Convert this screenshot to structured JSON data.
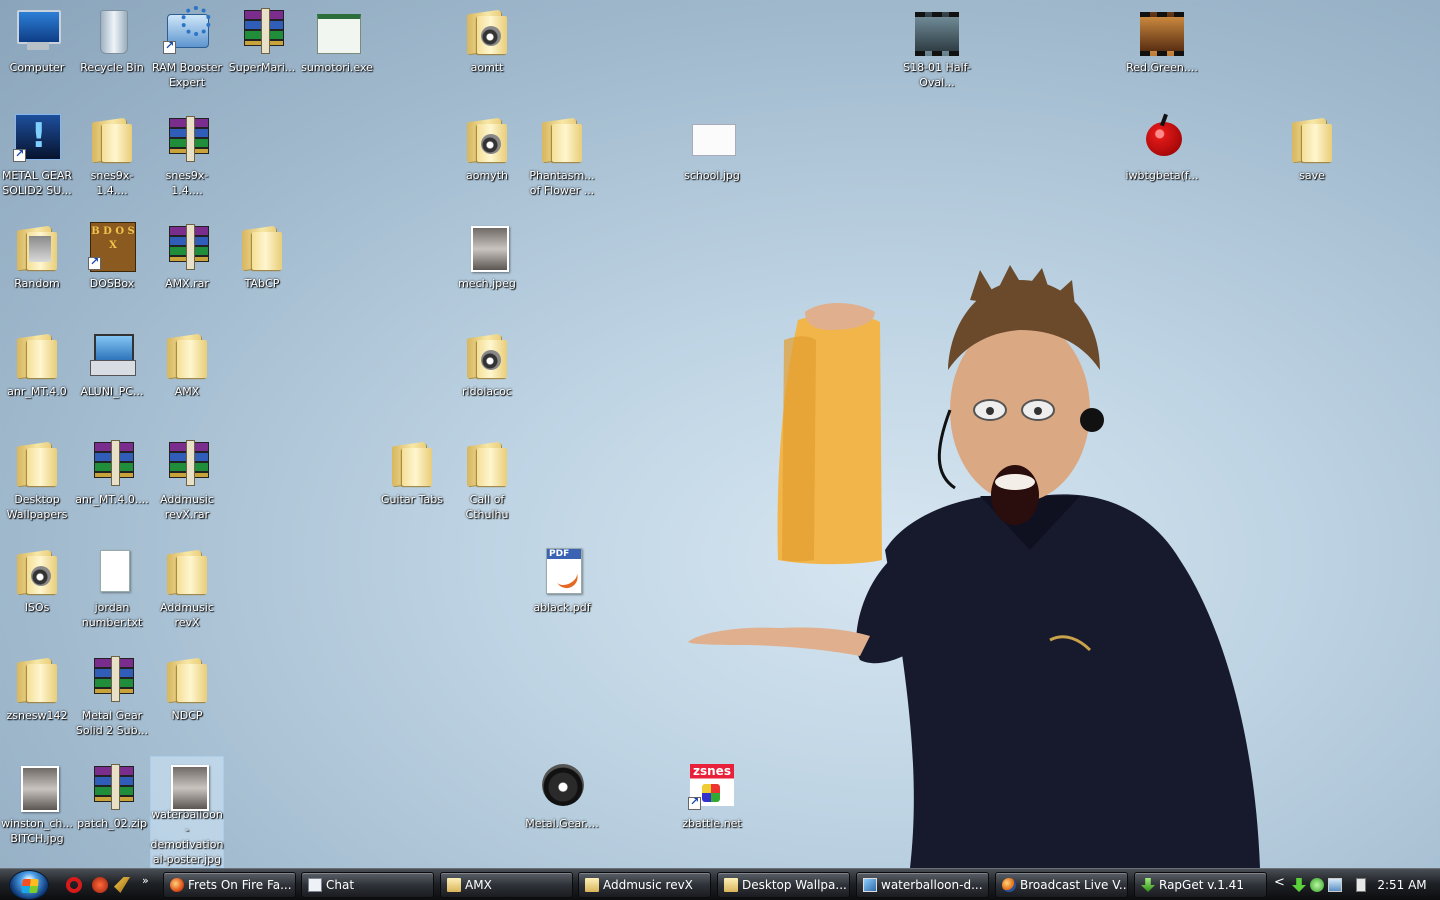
{
  "desktop": {
    "icons": {
      "computer": "Computer",
      "recycle_bin": "Recycle Bin",
      "ram_booster": "RAM Booster Expert",
      "supermario": "SuperMari...",
      "sumotori": "sumotori.exe",
      "aomtt": "aomtt",
      "s18_01": "S18-01 Half-Oval...",
      "red_green": "Red.Green....",
      "metal_gear_solid2": "METAL GEAR SOLID2 SU...",
      "snes9x_folder": "snes9x-1.4....",
      "snes9x_rar": "snes9x-1.4....",
      "aomyth": "aomyth",
      "phantasm": "Phantasm... of Flower ...",
      "school": "school.jpg",
      "iwbtgbeta": "iwbtgbeta(f...",
      "save": "save",
      "random": "Random",
      "dosbox": "DOSBox",
      "amx_rar": "AMX.rar",
      "tabcp": "TAbCP",
      "mech": "mech.jpeg",
      "anr_mt40": "anr_MT.4.0",
      "aluni_pc": "ALUNI_PC...",
      "amx": "AMX",
      "rldolacoc": "rldolacoc",
      "desktop_wallpapers": "Desktop Wallpapers",
      "anr_mt40_rar": "anr_MT.4.0....",
      "addmusic_revx_rar": "Addmusic revX.rar",
      "guitar_tabs": "Guitar Tabs",
      "call_of_cthulhu": "Call of Cthulhu",
      "isos": "ISOs",
      "jordan_number": "jordan number.txt",
      "addmusic_revx": "Addmusic revX",
      "ablack": "ablack.pdf",
      "zsnesw142": "zsnesw142",
      "metal_gear_solid2_sub": "Metal Gear Solid 2 Sub...",
      "ndcp": "NDCP",
      "winston": "winston_ch... BITCH.jpg",
      "patch02": "patch_02.zip",
      "waterballoon": "waterballoon-demotivational-poster.jpg",
      "metal_gear": "Metal.Gear....",
      "zbattle": "zbattle.net"
    }
  },
  "taskbar": {
    "more_glyph": "»",
    "tasks": [
      {
        "label": "Frets On Fire Fa...",
        "icon": "fire-icon"
      },
      {
        "label": "Chat",
        "icon": "chat-window-icon"
      },
      {
        "label": "AMX",
        "icon": "folder-icon"
      },
      {
        "label": "Addmusic revX",
        "icon": "folder-icon"
      },
      {
        "label": "Desktop Wallpa...",
        "icon": "folder-icon"
      },
      {
        "label": "waterballoon-d...",
        "icon": "picture-icon"
      },
      {
        "label": "Broadcast Live V...",
        "icon": "firefox-icon"
      },
      {
        "label": "RapGet v.1.41",
        "icon": "download-icon"
      }
    ],
    "tray_arrow": "<",
    "clock": "2:51 AM"
  },
  "colors": {
    "wallpaper": "#bcd2e2",
    "taskbar": "#1f2226",
    "shirt": "#171a2c",
    "cloth": "#f2b54a"
  }
}
